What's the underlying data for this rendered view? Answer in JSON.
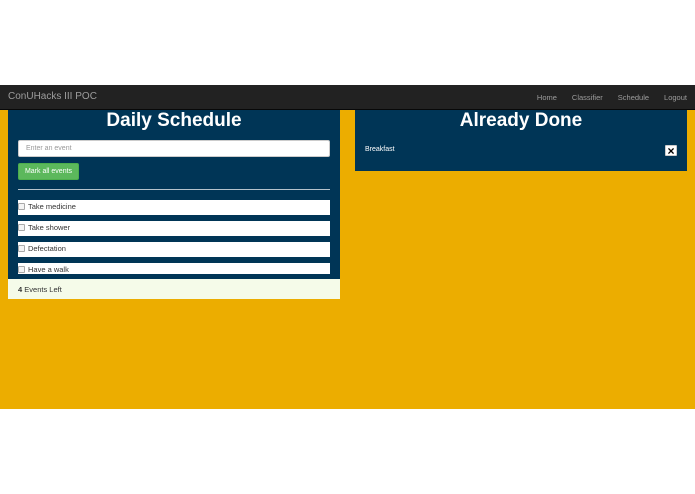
{
  "navbar": {
    "brand": "ConUHacks III POC",
    "links": [
      "Home",
      "Classifier",
      "Schedule",
      "Logout"
    ]
  },
  "schedule": {
    "title": "Daily Schedule",
    "input_placeholder": "Enter an event",
    "mark_all_label": "Mark all events",
    "items": [
      {
        "label": "Take medicine",
        "checked": false
      },
      {
        "label": "Take shower",
        "checked": false
      },
      {
        "label": "Defectation",
        "checked": false
      },
      {
        "label": "Have a walk",
        "checked": false
      }
    ],
    "footer_count": "4",
    "footer_label": "Events Left"
  },
  "done": {
    "title": "Already Done",
    "items": [
      {
        "label": "Breakfast"
      }
    ]
  },
  "colors": {
    "background": "#ecad00",
    "panel": "#003556",
    "navbar": "#222222",
    "button": "#5cb85c"
  }
}
